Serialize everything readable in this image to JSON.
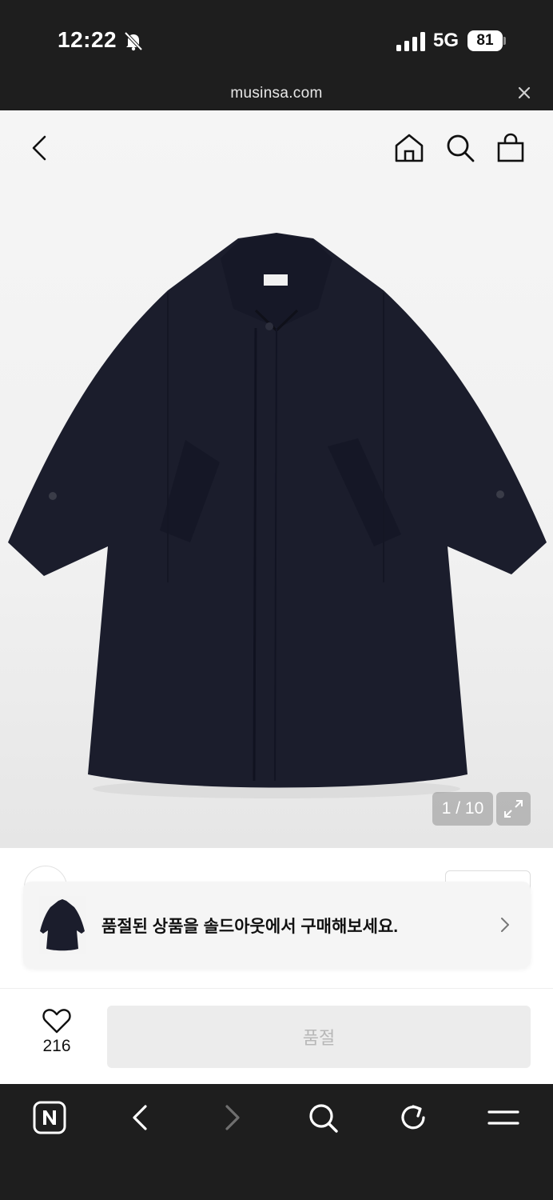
{
  "status_bar": {
    "time": "12:22",
    "network": "5G",
    "battery": "81"
  },
  "browser": {
    "url": "musinsa.com"
  },
  "gallery": {
    "counter": "1 / 10"
  },
  "banner": {
    "text": "품절된 상품을 솔드아웃에서 구매해보세요."
  },
  "actions": {
    "like_count": "216",
    "soldout_label": "품절"
  },
  "colors": {
    "coat": "#1a1c2b",
    "button_bg": "#ececec",
    "button_text": "#b8b8b8",
    "chrome": "#1e1e1e"
  },
  "icons": [
    "bell-slash-icon",
    "signal-icon",
    "close-icon",
    "back-icon",
    "home-icon",
    "search-icon",
    "bag-icon",
    "expand-icon",
    "chevron-right-icon",
    "heart-icon",
    "naver-icon",
    "forward-icon",
    "refresh-icon",
    "menu-icon"
  ]
}
